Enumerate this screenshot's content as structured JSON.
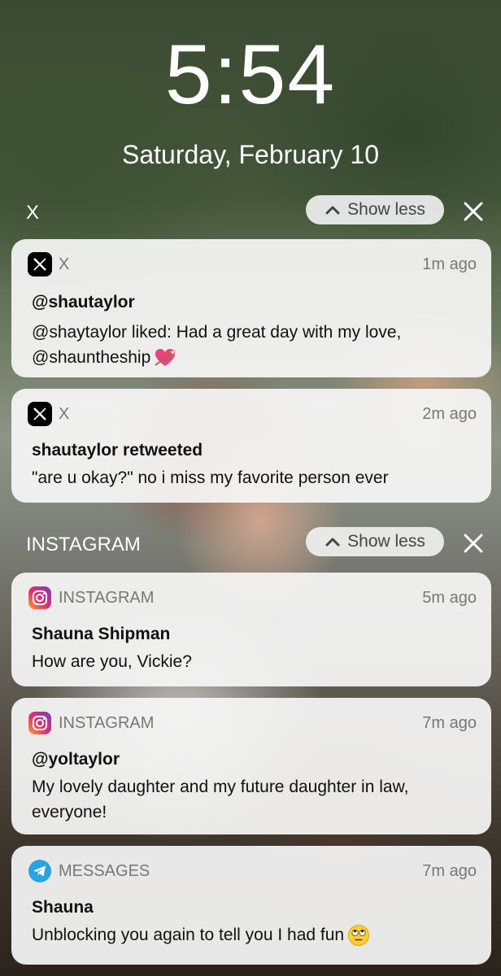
{
  "lock_screen": {
    "time": "5:54",
    "date": "Saturday, February 10"
  },
  "groups": {
    "x": {
      "title": "X",
      "show_less_label": "Show less",
      "notifications": [
        {
          "app": "X",
          "icon": "x-logo-icon",
          "time": "1m ago",
          "title": "@shautaylor",
          "body_line1": "@shaytaylor liked: Had a great day with my love,",
          "body_line2": "@shauntheship",
          "emoji": "heart-with-arrow-emoji"
        },
        {
          "app": "X",
          "icon": "x-logo-icon",
          "time": "2m ago",
          "title": "shautaylor retweeted",
          "body_line1": "\"are u okay?\" no i miss my favorite person ever"
        }
      ]
    },
    "instagram": {
      "title": "INSTAGRAM",
      "show_less_label": "Show less",
      "notifications": [
        {
          "app": "INSTAGRAM",
          "icon": "instagram-icon",
          "time": "5m ago",
          "title": "Shauna Shipman",
          "body_line1": "How are you, Vickie?"
        },
        {
          "app": "INSTAGRAM",
          "icon": "instagram-icon",
          "time": "7m ago",
          "title": "@yoltaylor",
          "body_line1": "My lovely daughter and my future daughter in law,",
          "body_line2": "everyone!"
        }
      ]
    },
    "messages": {
      "notifications": [
        {
          "app": "MESSAGES",
          "icon": "telegram-icon",
          "time": "7m ago",
          "title": "Shauna",
          "body_line1": "Unblocking you again to tell you I had fun",
          "emoji": "eye-roll-emoji"
        }
      ]
    }
  },
  "colors": {
    "card_bg": "#f6f6f6",
    "secondary_text": "#777777",
    "telegram_blue": "#2aa3e3",
    "x_black": "#000000"
  }
}
